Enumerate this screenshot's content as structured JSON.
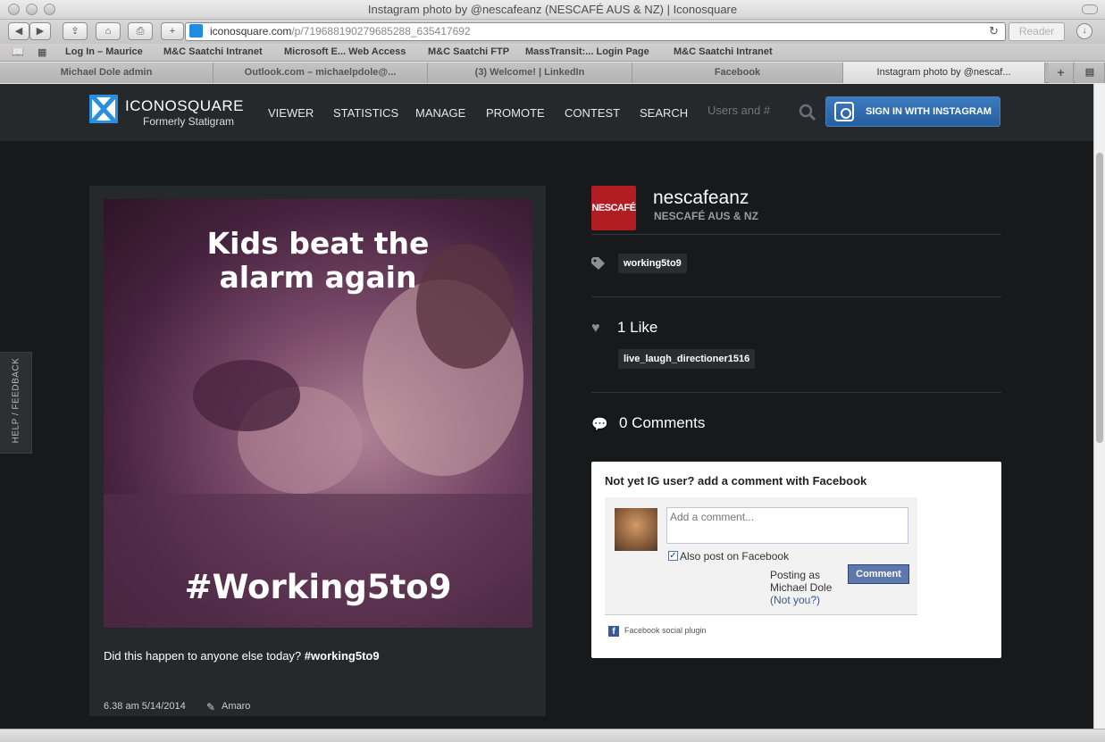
{
  "window": {
    "title": "Instagram photo by @nescafeanz (NESCAFÉ AUS & NZ) | Iconosquare"
  },
  "toolbar": {
    "back": "◀",
    "forward": "▶",
    "url_host": "iconosquare.com",
    "url_path": "/p/719688190279685288_635417692",
    "reload": "↻",
    "reader_label": "Reader"
  },
  "bookmarks": [
    "Log In – Maurice",
    "M&C Saatchi Intranet",
    "Microsoft E... Web Access",
    "M&C Saatchi FTP",
    "MassTransit:... Login Page",
    "M&C Saatchi Intranet"
  ],
  "tabs": [
    "Michael Dole admin",
    "Outlook.com – michaelpdole@...",
    "(3) Welcome! | LinkedIn",
    "Facebook",
    "Instagram photo by @nescaf..."
  ],
  "site": {
    "logo_text": "ICONOSQUARE",
    "logo_sub": "Formerly Statigram",
    "nav": [
      "VIEWER",
      "STATISTICS",
      "MANAGE",
      "PROMOTE",
      "CONTEST",
      "SEARCH"
    ],
    "search_placeholder": "Users and #",
    "signin_label": "SIGN IN WITH INSTAGRAM"
  },
  "photo": {
    "headline_line1": "Kids beat the",
    "headline_line2": "alarm again",
    "hashtag_overlay": "#Working5to9",
    "caption_text": "Did this happen to anyone else today? ",
    "caption_tag": "#working5to9",
    "date": "6.38 am 5/14/2014",
    "filter": "Amaro"
  },
  "profile": {
    "avatar_text": "NESCAFÉ",
    "username": "nescafeanz",
    "fullname": "NESCAFÉ AUS & NZ"
  },
  "tags": [
    "working5to9"
  ],
  "likes": {
    "label": "1 Like",
    "users": [
      "live_laugh_directioner1516"
    ]
  },
  "comments": {
    "label": "0 Comments"
  },
  "facebook": {
    "title": "Not yet IG user? add a comment with Facebook",
    "input_placeholder": "Add a comment...",
    "also_post_label": "Also post on Facebook",
    "posting_as": "Posting as",
    "posting_name": "Michael Dole",
    "not_you": "(Not you?)",
    "comment_button": "Comment",
    "plugin_label": "Facebook social plugin"
  },
  "feedback_label": "HELP / FEEDBACK",
  "colors": {
    "page_bg": "#17191b",
    "header_bg": "#26292c",
    "accent_blue": "#2a8fe0",
    "nescafe_red": "#b01e23",
    "facebook_blue": "#3b5998"
  }
}
